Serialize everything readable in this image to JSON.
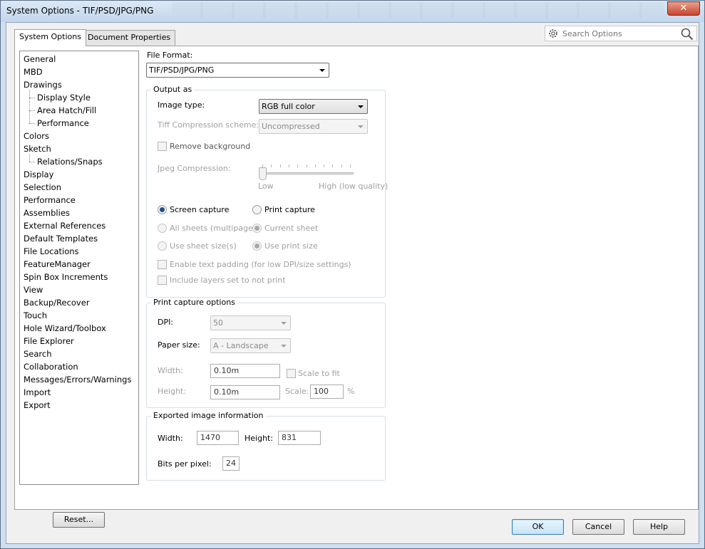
{
  "window": {
    "title": "System Options - TIF/PSD/JPG/PNG",
    "close_glyph": "✕"
  },
  "tabs": [
    {
      "label": "System Options",
      "active": true
    },
    {
      "label": "Document Properties",
      "active": false
    }
  ],
  "search": {
    "placeholder": "Search Options"
  },
  "tree": {
    "items": [
      {
        "label": "General",
        "level": 0
      },
      {
        "label": "MBD",
        "level": 0
      },
      {
        "label": "Drawings",
        "level": 0
      },
      {
        "label": "Display Style",
        "level": 1
      },
      {
        "label": "Area Hatch/Fill",
        "level": 1
      },
      {
        "label": "Performance",
        "level": 1
      },
      {
        "label": "Colors",
        "level": 0
      },
      {
        "label": "Sketch",
        "level": 0
      },
      {
        "label": "Relations/Snaps",
        "level": 1
      },
      {
        "label": "Display",
        "level": 0
      },
      {
        "label": "Selection",
        "level": 0
      },
      {
        "label": "Performance",
        "level": 0
      },
      {
        "label": "Assemblies",
        "level": 0
      },
      {
        "label": "External References",
        "level": 0
      },
      {
        "label": "Default Templates",
        "level": 0
      },
      {
        "label": "File Locations",
        "level": 0
      },
      {
        "label": "FeatureManager",
        "level": 0
      },
      {
        "label": "Spin Box Increments",
        "level": 0
      },
      {
        "label": "View",
        "level": 0
      },
      {
        "label": "Backup/Recover",
        "level": 0
      },
      {
        "label": "Touch",
        "level": 0
      },
      {
        "label": "Hole Wizard/Toolbox",
        "level": 0
      },
      {
        "label": "File Explorer",
        "level": 0
      },
      {
        "label": "Search",
        "level": 0
      },
      {
        "label": "Collaboration",
        "level": 0
      },
      {
        "label": "Messages/Errors/Warnings",
        "level": 0
      },
      {
        "label": "Import",
        "level": 0
      },
      {
        "label": "Export",
        "level": 0
      }
    ],
    "reset_label": "Reset..."
  },
  "file_format": {
    "label": "File Format:",
    "value": "TIF/PSD/JPG/PNG"
  },
  "output_as": {
    "title": "Output as",
    "image_type_label": "Image type:",
    "image_type_value": "RGB full color",
    "tiff_label": "Tiff Compression scheme:",
    "tiff_value": "Uncompressed",
    "remove_bg_label": "Remove background",
    "jpeg_label": "Jpeg Compression:",
    "jpeg_low": "Low",
    "jpeg_high": "High (low quality)",
    "jpeg_level": 0,
    "screen_capture": "Screen capture",
    "print_capture": "Print capture",
    "all_sheets": "All sheets (multipage)",
    "current_sheet": "Current sheet",
    "use_sheet_size": "Use sheet size(s)",
    "use_print_size": "Use print size",
    "text_padding": "Enable text padding (for low DPI/size settings)",
    "include_layers": "Include layers set to not print"
  },
  "print_capture_options": {
    "title": "Print capture options",
    "dpi_label": "DPI:",
    "dpi_value": "50",
    "paper_label": "Paper size:",
    "paper_value": "A - Landscape",
    "width_label": "Width:",
    "width_value": "0.10m",
    "height_label": "Height:",
    "height_value": "0.10m",
    "scale_fit_label": "Scale to fit",
    "scale_label": "Scale:",
    "scale_value": "100",
    "percent": "%"
  },
  "exported_info": {
    "title": "Exported image information",
    "width_label": "Width:",
    "width_value": "1470",
    "height_label": "Height:",
    "height_value": "831",
    "bpp_label": "Bits per pixel:",
    "bpp_value": "24"
  },
  "buttons": {
    "ok": "OK",
    "cancel": "Cancel",
    "help": "Help"
  }
}
